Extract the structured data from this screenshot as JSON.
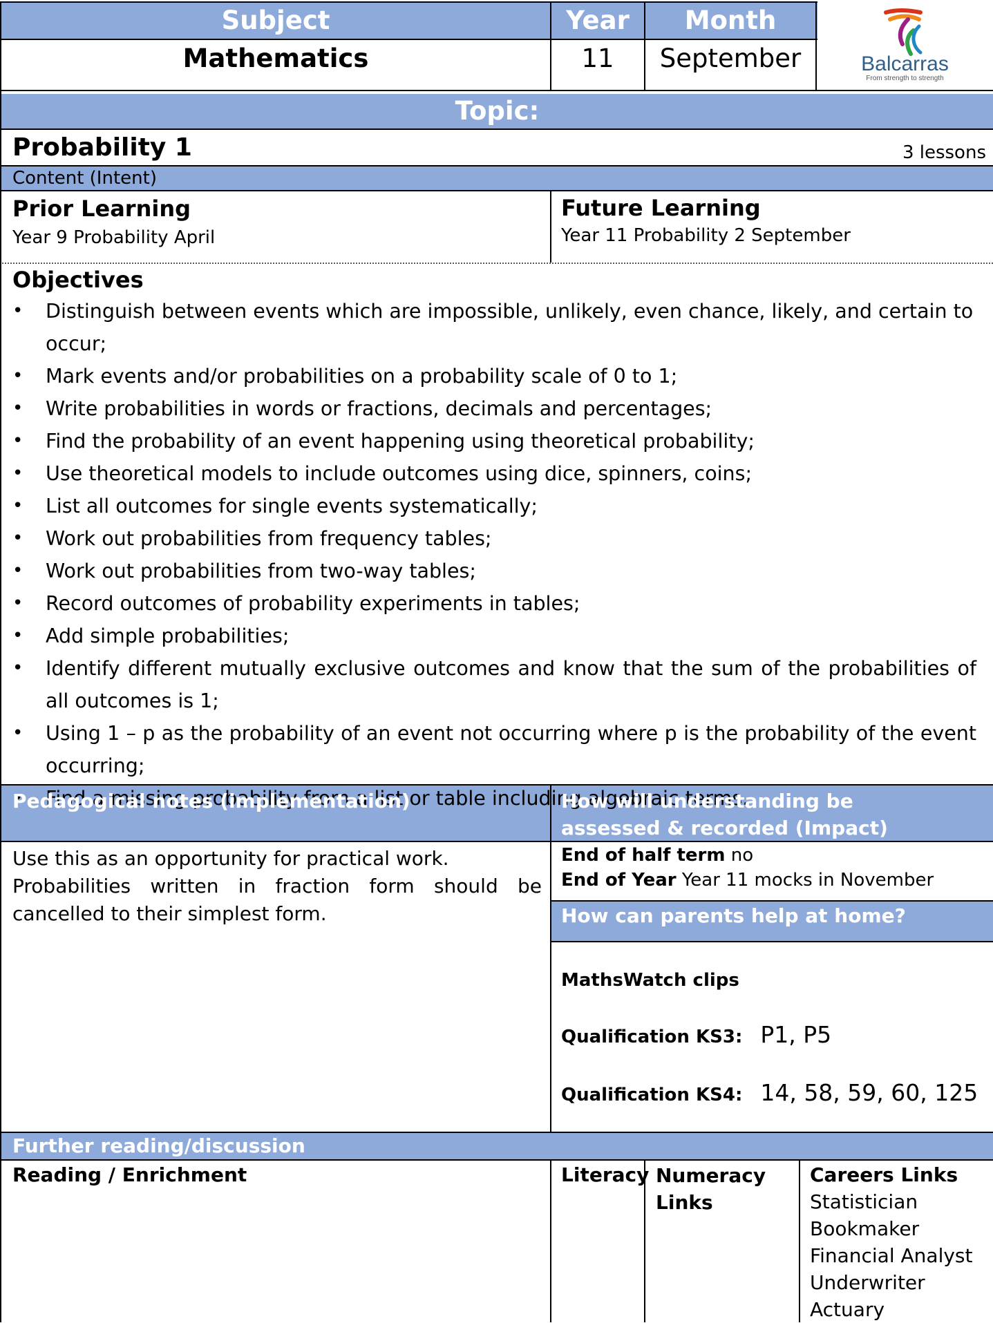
{
  "header": {
    "subject_label": "Subject",
    "year_label": "Year",
    "month_label": "Month",
    "subject_value": "Mathematics",
    "year_value": "11",
    "month_value": "September",
    "logo_name": "Balcarras",
    "logo_tagline": "From strength to strength"
  },
  "topic": {
    "label": "Topic:",
    "title": "Probability 1",
    "lessons": "3 lessons"
  },
  "content_intent": "Content (Intent)",
  "prior": {
    "label": "Prior Learning",
    "text": "Year 9 Probability April"
  },
  "future": {
    "label": "Future Learning",
    "text": "Year 11 Probability 2 September"
  },
  "objectives": {
    "label": "Objectives",
    "items": [
      "Distinguish between events which are impossible, unlikely, even chance, likely, and certain to occur;",
      "Mark events and/or probabilities on a probability scale of 0 to 1;",
      "Write probabilities in words or fractions, decimals and percentages;",
      "Find the probability of an event happening using theoretical probability;",
      "Use theoretical models to include outcomes using dice, spinners, coins;",
      "List all outcomes for single events systematically;",
      "Work out probabilities from frequency tables;",
      "Work out probabilities from two-way tables;",
      "Record outcomes of probability experiments in tables;",
      "Add simple probabilities;",
      "Identify different mutually exclusive outcomes and know that the sum of the probabilities of all outcomes is 1;",
      "Using 1 – p as the probability of an event not occurring where p is the probability of the event occurring;",
      "Find a missing probability from a list or table including algebraic terms."
    ]
  },
  "pedagogy": {
    "label": "Pedagogical notes (implementation)",
    "line1": "Use this as an opportunity for practical work.",
    "line2": "Probabilities written in fraction form should be cancelled to their simplest form."
  },
  "assessment": {
    "label": "How will understanding be assessed & recorded (Impact)",
    "half_term_label": "End of half term",
    "half_term_value": "no",
    "year_label": "End of Year",
    "year_value": "Year 11 mocks in November"
  },
  "parents": {
    "label": "How can parents help at home?",
    "clips_label": "MathsWatch clips",
    "ks3_label": "Qualification KS3:",
    "ks3_value": "P1, P5",
    "ks4_label": "Qualification KS4:",
    "ks4_value": "14, 58, 59, 60, 125"
  },
  "further": {
    "label": "Further reading/discussion",
    "reading_label": "Reading / Enrichment",
    "literacy_label": "Literacy",
    "numeracy_label": "Numeracy Links",
    "careers_label": "Careers Links",
    "careers": [
      "Statistician",
      "Bookmaker",
      "Financial Analyst",
      "Underwriter",
      "Actuary"
    ]
  },
  "colors": {
    "header_blue": "#8eaadb",
    "logo_blue": "#2f5f8a"
  }
}
